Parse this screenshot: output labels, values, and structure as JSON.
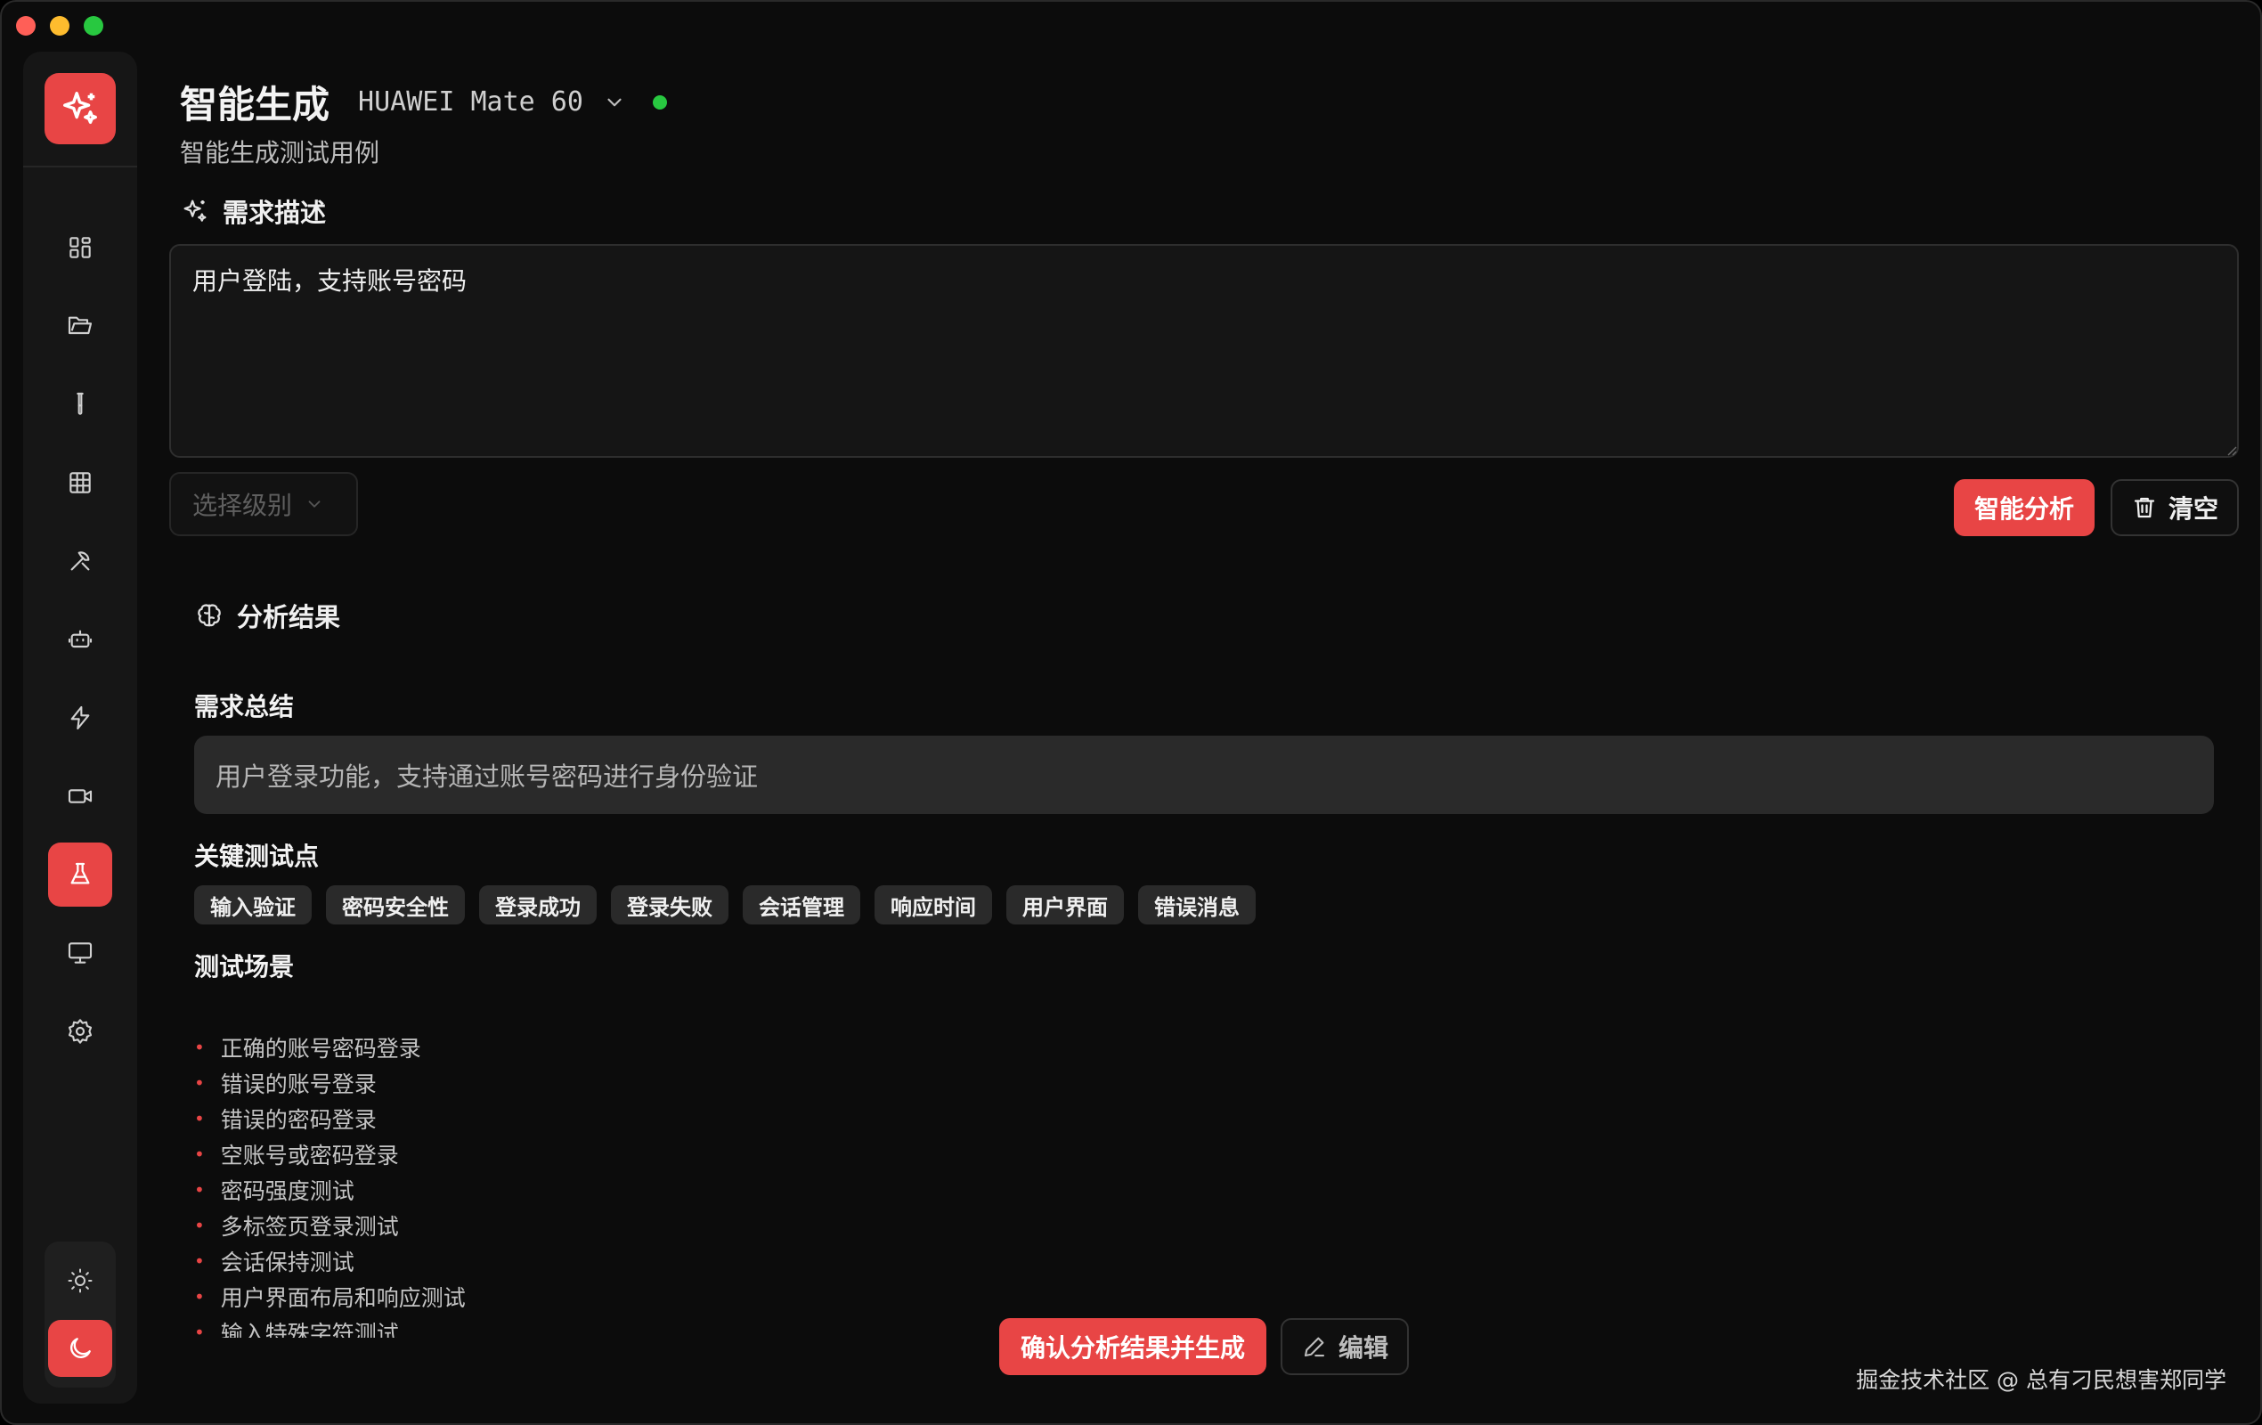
{
  "header": {
    "title": "智能生成",
    "device": "HUAWEI Mate 60",
    "subtitle": "智能生成测试用例"
  },
  "requirement": {
    "section_title": "需求描述",
    "text": "用户登陆，支持账号密码",
    "level_placeholder": "选择级别",
    "analyze_label": "智能分析",
    "clear_label": "清空"
  },
  "analysis": {
    "section_title": "分析结果",
    "summary_title": "需求总结",
    "summary": "用户登录功能，支持通过账号密码进行身份验证",
    "keypoints_title": "关键测试点",
    "keypoints": [
      "输入验证",
      "密码安全性",
      "登录成功",
      "登录失败",
      "会话管理",
      "响应时间",
      "用户界面",
      "错误消息"
    ],
    "scenarios_title": "测试场景",
    "scenarios": [
      "正确的账号密码登录",
      "错误的账号登录",
      "错误的密码登录",
      "空账号或密码登录",
      "密码强度测试",
      "多标签页登录测试",
      "会话保持测试",
      "用户界面布局和响应测试",
      "输入特殊字符测试"
    ]
  },
  "actions": {
    "confirm_label": "确认分析结果并生成",
    "edit_label": "编辑"
  },
  "watermark": "掘金技术社区 @ 总有刁民想害郑同学",
  "sidebar": {
    "icons": [
      "dashboard-icon",
      "folder-icon",
      "test-tube-icon",
      "table-icon",
      "tools-icon",
      "robot-icon",
      "lightning-icon",
      "video-icon",
      "flask-icon",
      "monitor-icon",
      "settings-icon"
    ],
    "active": "flask-icon"
  },
  "colors": {
    "accent": "#e84545",
    "status": "#28c840",
    "background": "#0c0c0c"
  }
}
